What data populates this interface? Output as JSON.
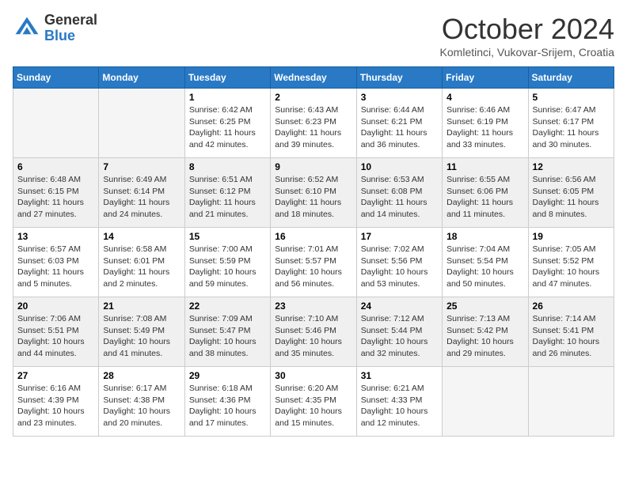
{
  "header": {
    "logo_general": "General",
    "logo_blue": "Blue",
    "title": "October 2024",
    "location": "Komletinci, Vukovar-Srijem, Croatia"
  },
  "days_of_week": [
    "Sunday",
    "Monday",
    "Tuesday",
    "Wednesday",
    "Thursday",
    "Friday",
    "Saturday"
  ],
  "weeks": [
    [
      {
        "day": "",
        "empty": true
      },
      {
        "day": "",
        "empty": true
      },
      {
        "day": "1",
        "sunrise": "Sunrise: 6:42 AM",
        "sunset": "Sunset: 6:25 PM",
        "daylight": "Daylight: 11 hours and 42 minutes."
      },
      {
        "day": "2",
        "sunrise": "Sunrise: 6:43 AM",
        "sunset": "Sunset: 6:23 PM",
        "daylight": "Daylight: 11 hours and 39 minutes."
      },
      {
        "day": "3",
        "sunrise": "Sunrise: 6:44 AM",
        "sunset": "Sunset: 6:21 PM",
        "daylight": "Daylight: 11 hours and 36 minutes."
      },
      {
        "day": "4",
        "sunrise": "Sunrise: 6:46 AM",
        "sunset": "Sunset: 6:19 PM",
        "daylight": "Daylight: 11 hours and 33 minutes."
      },
      {
        "day": "5",
        "sunrise": "Sunrise: 6:47 AM",
        "sunset": "Sunset: 6:17 PM",
        "daylight": "Daylight: 11 hours and 30 minutes."
      }
    ],
    [
      {
        "day": "6",
        "sunrise": "Sunrise: 6:48 AM",
        "sunset": "Sunset: 6:15 PM",
        "daylight": "Daylight: 11 hours and 27 minutes."
      },
      {
        "day": "7",
        "sunrise": "Sunrise: 6:49 AM",
        "sunset": "Sunset: 6:14 PM",
        "daylight": "Daylight: 11 hours and 24 minutes."
      },
      {
        "day": "8",
        "sunrise": "Sunrise: 6:51 AM",
        "sunset": "Sunset: 6:12 PM",
        "daylight": "Daylight: 11 hours and 21 minutes."
      },
      {
        "day": "9",
        "sunrise": "Sunrise: 6:52 AM",
        "sunset": "Sunset: 6:10 PM",
        "daylight": "Daylight: 11 hours and 18 minutes."
      },
      {
        "day": "10",
        "sunrise": "Sunrise: 6:53 AM",
        "sunset": "Sunset: 6:08 PM",
        "daylight": "Daylight: 11 hours and 14 minutes."
      },
      {
        "day": "11",
        "sunrise": "Sunrise: 6:55 AM",
        "sunset": "Sunset: 6:06 PM",
        "daylight": "Daylight: 11 hours and 11 minutes."
      },
      {
        "day": "12",
        "sunrise": "Sunrise: 6:56 AM",
        "sunset": "Sunset: 6:05 PM",
        "daylight": "Daylight: 11 hours and 8 minutes."
      }
    ],
    [
      {
        "day": "13",
        "sunrise": "Sunrise: 6:57 AM",
        "sunset": "Sunset: 6:03 PM",
        "daylight": "Daylight: 11 hours and 5 minutes."
      },
      {
        "day": "14",
        "sunrise": "Sunrise: 6:58 AM",
        "sunset": "Sunset: 6:01 PM",
        "daylight": "Daylight: 11 hours and 2 minutes."
      },
      {
        "day": "15",
        "sunrise": "Sunrise: 7:00 AM",
        "sunset": "Sunset: 5:59 PM",
        "daylight": "Daylight: 10 hours and 59 minutes."
      },
      {
        "day": "16",
        "sunrise": "Sunrise: 7:01 AM",
        "sunset": "Sunset: 5:57 PM",
        "daylight": "Daylight: 10 hours and 56 minutes."
      },
      {
        "day": "17",
        "sunrise": "Sunrise: 7:02 AM",
        "sunset": "Sunset: 5:56 PM",
        "daylight": "Daylight: 10 hours and 53 minutes."
      },
      {
        "day": "18",
        "sunrise": "Sunrise: 7:04 AM",
        "sunset": "Sunset: 5:54 PM",
        "daylight": "Daylight: 10 hours and 50 minutes."
      },
      {
        "day": "19",
        "sunrise": "Sunrise: 7:05 AM",
        "sunset": "Sunset: 5:52 PM",
        "daylight": "Daylight: 10 hours and 47 minutes."
      }
    ],
    [
      {
        "day": "20",
        "sunrise": "Sunrise: 7:06 AM",
        "sunset": "Sunset: 5:51 PM",
        "daylight": "Daylight: 10 hours and 44 minutes."
      },
      {
        "day": "21",
        "sunrise": "Sunrise: 7:08 AM",
        "sunset": "Sunset: 5:49 PM",
        "daylight": "Daylight: 10 hours and 41 minutes."
      },
      {
        "day": "22",
        "sunrise": "Sunrise: 7:09 AM",
        "sunset": "Sunset: 5:47 PM",
        "daylight": "Daylight: 10 hours and 38 minutes."
      },
      {
        "day": "23",
        "sunrise": "Sunrise: 7:10 AM",
        "sunset": "Sunset: 5:46 PM",
        "daylight": "Daylight: 10 hours and 35 minutes."
      },
      {
        "day": "24",
        "sunrise": "Sunrise: 7:12 AM",
        "sunset": "Sunset: 5:44 PM",
        "daylight": "Daylight: 10 hours and 32 minutes."
      },
      {
        "day": "25",
        "sunrise": "Sunrise: 7:13 AM",
        "sunset": "Sunset: 5:42 PM",
        "daylight": "Daylight: 10 hours and 29 minutes."
      },
      {
        "day": "26",
        "sunrise": "Sunrise: 7:14 AM",
        "sunset": "Sunset: 5:41 PM",
        "daylight": "Daylight: 10 hours and 26 minutes."
      }
    ],
    [
      {
        "day": "27",
        "sunrise": "Sunrise: 6:16 AM",
        "sunset": "Sunset: 4:39 PM",
        "daylight": "Daylight: 10 hours and 23 minutes."
      },
      {
        "day": "28",
        "sunrise": "Sunrise: 6:17 AM",
        "sunset": "Sunset: 4:38 PM",
        "daylight": "Daylight: 10 hours and 20 minutes."
      },
      {
        "day": "29",
        "sunrise": "Sunrise: 6:18 AM",
        "sunset": "Sunset: 4:36 PM",
        "daylight": "Daylight: 10 hours and 17 minutes."
      },
      {
        "day": "30",
        "sunrise": "Sunrise: 6:20 AM",
        "sunset": "Sunset: 4:35 PM",
        "daylight": "Daylight: 10 hours and 15 minutes."
      },
      {
        "day": "31",
        "sunrise": "Sunrise: 6:21 AM",
        "sunset": "Sunset: 4:33 PM",
        "daylight": "Daylight: 10 hours and 12 minutes."
      },
      {
        "day": "",
        "empty": true
      },
      {
        "day": "",
        "empty": true
      }
    ]
  ]
}
